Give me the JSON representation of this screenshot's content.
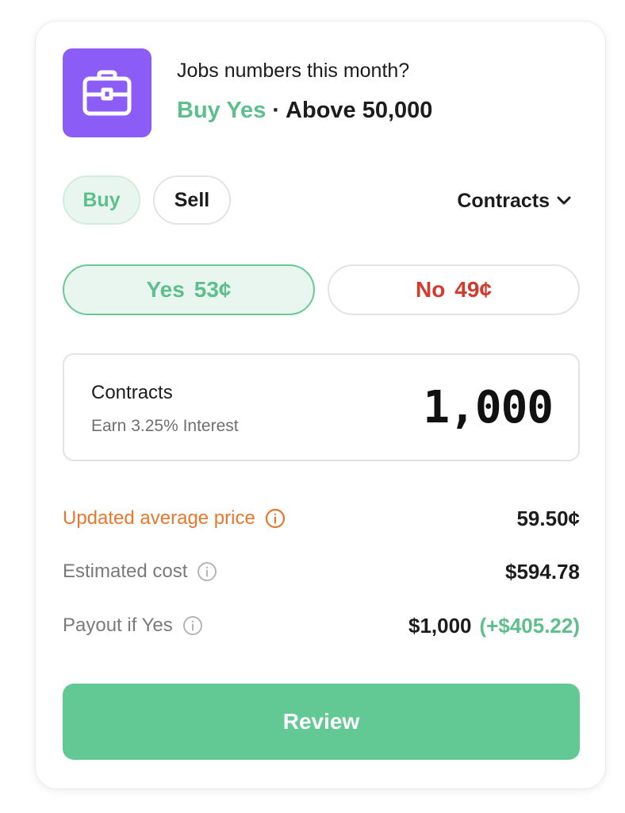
{
  "market": {
    "icon": "briefcase-icon",
    "question": "Jobs numbers this month?",
    "side_label": "Buy Yes",
    "separator": "·",
    "target": "Above 50,000"
  },
  "order_side": {
    "buy_label": "Buy",
    "sell_label": "Sell",
    "selected": "Buy"
  },
  "units": {
    "label": "Contracts",
    "icon": "chevron-down-icon"
  },
  "outcomes": {
    "yes_label": "Yes",
    "yes_price": "53¢",
    "no_label": "No",
    "no_price": "49¢",
    "selected": "Yes"
  },
  "quantity": {
    "label": "Contracts",
    "sublabel": "Earn 3.25% Interest",
    "value": "1,000"
  },
  "summary": {
    "avg_price_label": "Updated average price",
    "avg_price_value": "59.50¢",
    "cost_label": "Estimated cost",
    "cost_value": "$594.78",
    "payout_label": "Payout if Yes",
    "payout_value": "$1,000",
    "payout_gain": "(+$405.22)"
  },
  "actions": {
    "review_label": "Review"
  },
  "colors": {
    "brand_green": "#62c995",
    "yes_text": "#5dbf8c",
    "no_text": "#d23a2c",
    "warning_orange": "#e8772e",
    "icon_tile_purple": "#8b5cf6"
  }
}
